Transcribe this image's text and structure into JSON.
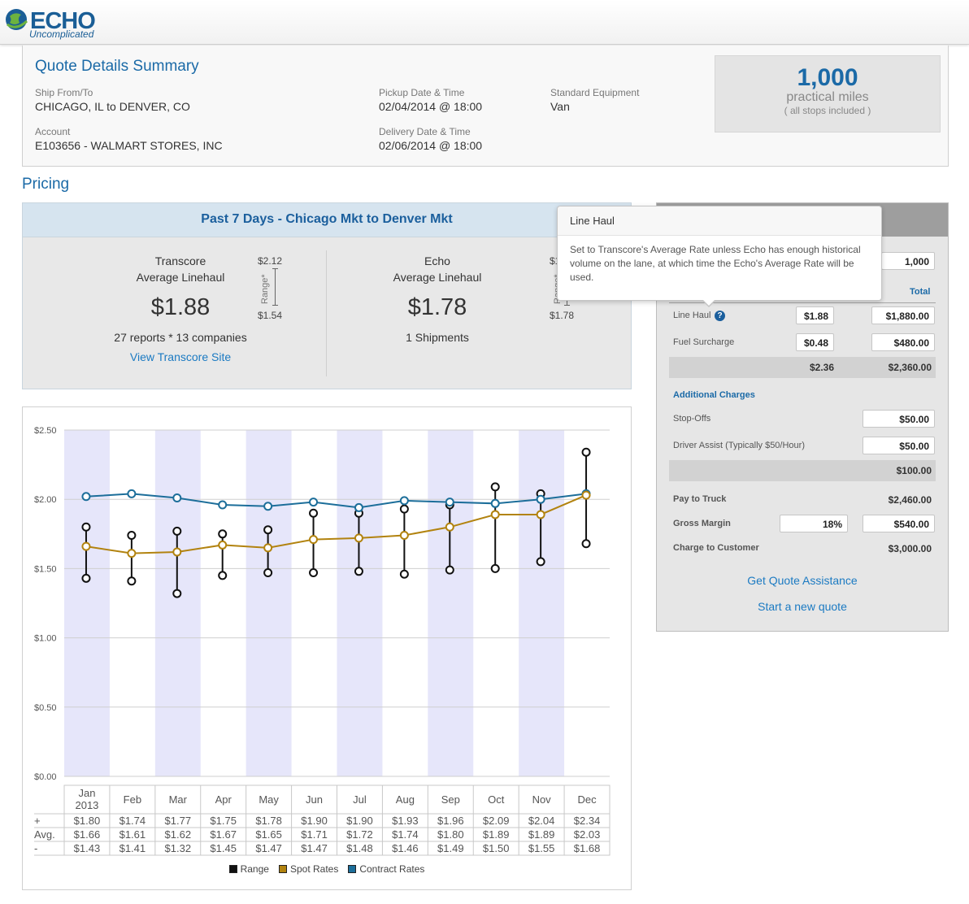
{
  "brand": {
    "name": "ECHO",
    "tagline": "Uncomplicated"
  },
  "summary": {
    "title": "Quote Details Summary",
    "ship_label": "Ship From/To",
    "ship_value": "CHICAGO, IL to DENVER, CO",
    "account_label": "Account",
    "account_value": "E103656 - WALMART STORES, INC",
    "pickup_label": "Pickup Date & Time",
    "pickup_value": "02/04/2014 @ 18:00",
    "delivery_label": "Delivery Date & Time",
    "delivery_value": "02/06/2014 @ 18:00",
    "equipment_label": "Standard Equipment",
    "equipment_value": "Van",
    "miles_value": "1,000",
    "miles_label": "practical miles",
    "miles_note": "( all stops included )"
  },
  "pricing": {
    "title": "Pricing",
    "market_title": "Past 7 Days - Chicago Mkt to Denver Mkt",
    "transcore": {
      "name": "Transcore",
      "subtitle": "Average Linehaul",
      "price": "$1.88",
      "range_high": "$2.12",
      "range_low": "$1.54",
      "range_label": "Range*",
      "stat": "27 reports * 13 companies",
      "link": "View Transcore Site"
    },
    "echo": {
      "name": "Echo",
      "subtitle": "Average Linehaul",
      "price": "$1.78",
      "range_high": "$1",
      "range_low": "$1.78",
      "range_label": "Range*",
      "stat": "1 Shipments"
    }
  },
  "tooltip": {
    "title": "Line Haul",
    "body": "Set to Transcore's Average Rate unless Echo has enough historical volume on the lane, at which time the Echo's Average Rate will be used."
  },
  "calculator": {
    "miles_input": "1,000",
    "total_header": "Total",
    "line_haul_label": "Line Haul",
    "line_haul_rate": "$1.88",
    "line_haul_total": "$1,880.00",
    "fuel_label": "Fuel Surcharge",
    "fuel_rate": "$0.48",
    "fuel_total": "$480.00",
    "subtotal_rate": "$2.36",
    "subtotal_total": "$2,360.00",
    "additional_title": "Additional Charges",
    "stopoffs_label": "Stop-Offs",
    "stopoffs_value": "$50.00",
    "driver_label": "Driver Assist (Typically $50/Hour)",
    "driver_value": "$50.00",
    "additional_total": "$100.00",
    "pay_label": "Pay to Truck",
    "pay_value": "$2,460.00",
    "margin_label": "Gross Margin",
    "margin_pct": "18%",
    "margin_value": "$540.00",
    "charge_label": "Charge to Customer",
    "charge_value": "$3,000.00",
    "assist_link": "Get Quote Assistance",
    "new_quote_link": "Start a new quote"
  },
  "chart_data": {
    "type": "line",
    "categories": [
      "Jan 2013",
      "Feb",
      "Mar",
      "Apr",
      "May",
      "Jun",
      "Jul",
      "Aug",
      "Sep",
      "Oct",
      "Nov",
      "Dec"
    ],
    "y_ticks": [
      "$0.00",
      "$0.50",
      "$1.00",
      "$1.50",
      "$2.00",
      "$2.50"
    ],
    "ylim": [
      0,
      2.5
    ],
    "grid": true,
    "legend_position": "bottom",
    "series": [
      {
        "name": "Contract Rates",
        "color": "#1c6e9a",
        "values": [
          2.02,
          2.04,
          2.01,
          1.96,
          1.95,
          1.98,
          1.94,
          1.99,
          1.98,
          1.97,
          2.0,
          2.04
        ]
      },
      {
        "name": "Spot Rates",
        "color": "#b2830f",
        "values": [
          1.66,
          1.61,
          1.62,
          1.67,
          1.65,
          1.71,
          1.72,
          1.74,
          1.8,
          1.89,
          1.89,
          2.03
        ]
      },
      {
        "name": "Range",
        "color": "#111111",
        "high": [
          1.8,
          1.74,
          1.77,
          1.75,
          1.78,
          1.9,
          1.9,
          1.93,
          1.96,
          2.09,
          2.04,
          2.34
        ],
        "low": [
          1.43,
          1.41,
          1.32,
          1.45,
          1.47,
          1.47,
          1.48,
          1.46,
          1.49,
          1.5,
          1.55,
          1.68
        ]
      }
    ],
    "table": {
      "row_labels": [
        "+",
        "Avg.",
        "-"
      ],
      "rows": [
        [
          "$1.80",
          "$1.74",
          "$1.77",
          "$1.75",
          "$1.78",
          "$1.90",
          "$1.90",
          "$1.93",
          "$1.96",
          "$2.09",
          "$2.04",
          "$2.34"
        ],
        [
          "$1.66",
          "$1.61",
          "$1.62",
          "$1.67",
          "$1.65",
          "$1.71",
          "$1.72",
          "$1.74",
          "$1.80",
          "$1.89",
          "$1.89",
          "$2.03"
        ],
        [
          "$1.43",
          "$1.41",
          "$1.32",
          "$1.45",
          "$1.47",
          "$1.47",
          "$1.48",
          "$1.46",
          "$1.49",
          "$1.50",
          "$1.55",
          "$1.68"
        ]
      ]
    },
    "legend": [
      {
        "label": "Range",
        "color": "#111111"
      },
      {
        "label": "Spot Rates",
        "color": "#b2830f"
      },
      {
        "label": "Contract Rates",
        "color": "#1c6e9a"
      }
    ],
    "shade_color": "#e6e6fa"
  }
}
